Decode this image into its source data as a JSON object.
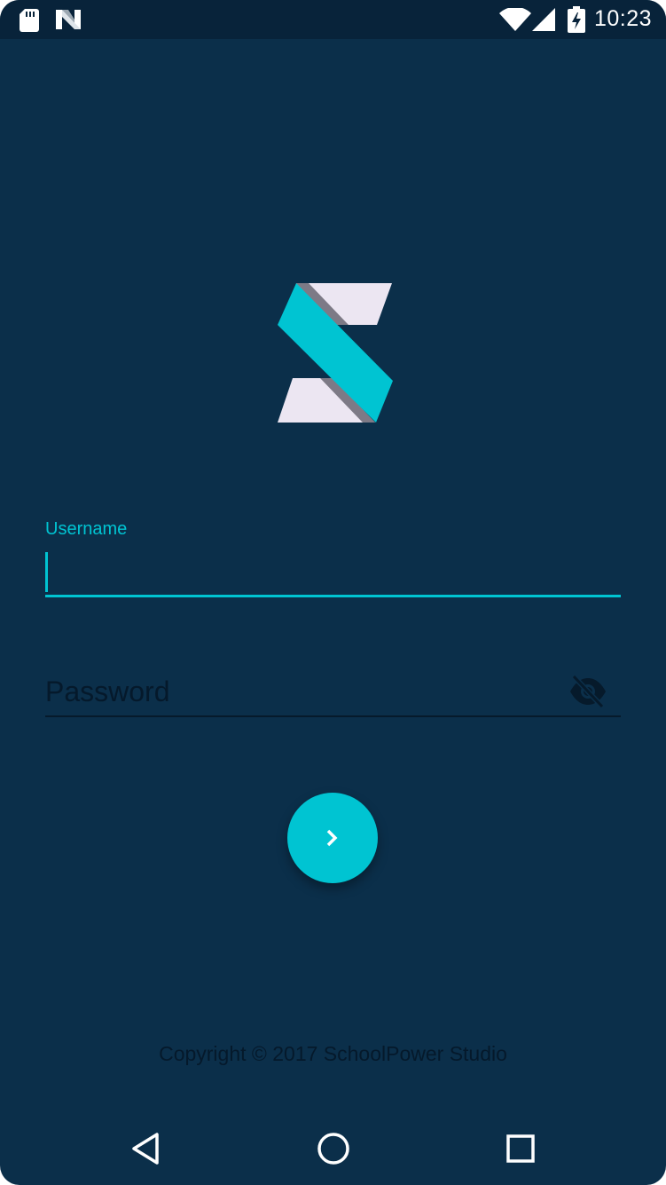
{
  "status_bar": {
    "time": "10:23",
    "icons": [
      "sd-card-icon",
      "n-notification-icon",
      "wifi-icon",
      "cell-signal-icon",
      "battery-charging-icon"
    ]
  },
  "login": {
    "username": {
      "label": "Username",
      "value": ""
    },
    "password": {
      "placeholder": "Password",
      "value": "",
      "toggle_icon": "visibility-off-icon"
    },
    "submit_icon": "chevron-right-icon"
  },
  "footer": {
    "copyright": "Copyright © 2017 SchoolPower Studio"
  },
  "nav_bar": {
    "icons": [
      "back-icon",
      "home-icon",
      "recents-icon"
    ]
  },
  "colors": {
    "background": "#0b2f4a",
    "status_bar": "#08233a",
    "accent": "#00c4d2",
    "logo_light": "#ece6f2",
    "dim_text": "#05192b"
  }
}
